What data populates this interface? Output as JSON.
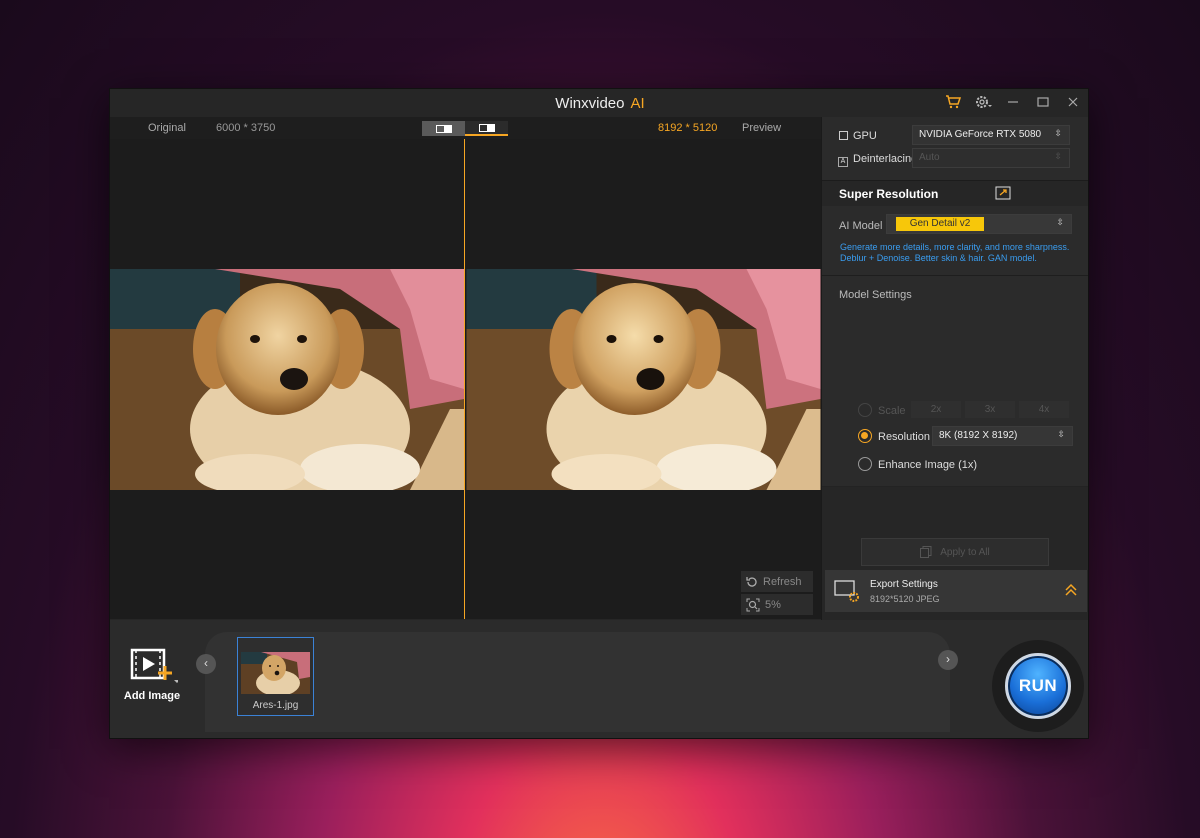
{
  "app": {
    "title": "Winxvideo",
    "title_ai": "AI",
    "accent": "#f6a623"
  },
  "titlebar_icons": [
    "cart-icon",
    "gear-icon",
    "minimize-icon",
    "maximize-icon",
    "close-icon"
  ],
  "preview": {
    "original_label": "Original",
    "original_size": "6000 * 3750",
    "preview_size": "8192 * 5120",
    "preview_label": "Preview",
    "refresh_label": "Refresh",
    "zoom_value": "5%"
  },
  "settings": {
    "gpu_label": "GPU",
    "gpu_value": "NVIDIA GeForce RTX 5080",
    "deinterlacing_label": "Deinterlacing",
    "deinterlacing_value": "Auto",
    "section_title": "Super Resolution",
    "ai_model_label": "AI Model",
    "ai_model_value": "Gen Detail v2",
    "ai_model_desc_1": "Generate more details, more clarity, and more sharpness.",
    "ai_model_desc_2": "Deblur + Denoise. Better skin & hair. GAN model.",
    "model_settings_label": "Model Settings",
    "scale_label": "Scale",
    "scale_options": [
      "2x",
      "3x",
      "4x"
    ],
    "resolution_label": "Resolution",
    "resolution_value": "8K (8192 X 8192)",
    "enhance_label": "Enhance Image (1x)",
    "selected_option": "Resolution",
    "apply_all_label": "Apply to All"
  },
  "export": {
    "title": "Export Settings",
    "detail": "8192*5120  JPEG"
  },
  "bottom": {
    "add_image_label": "Add Image",
    "files": [
      {
        "name": "Ares-1.jpg",
        "selected": true
      }
    ],
    "run_label": "RUN"
  }
}
